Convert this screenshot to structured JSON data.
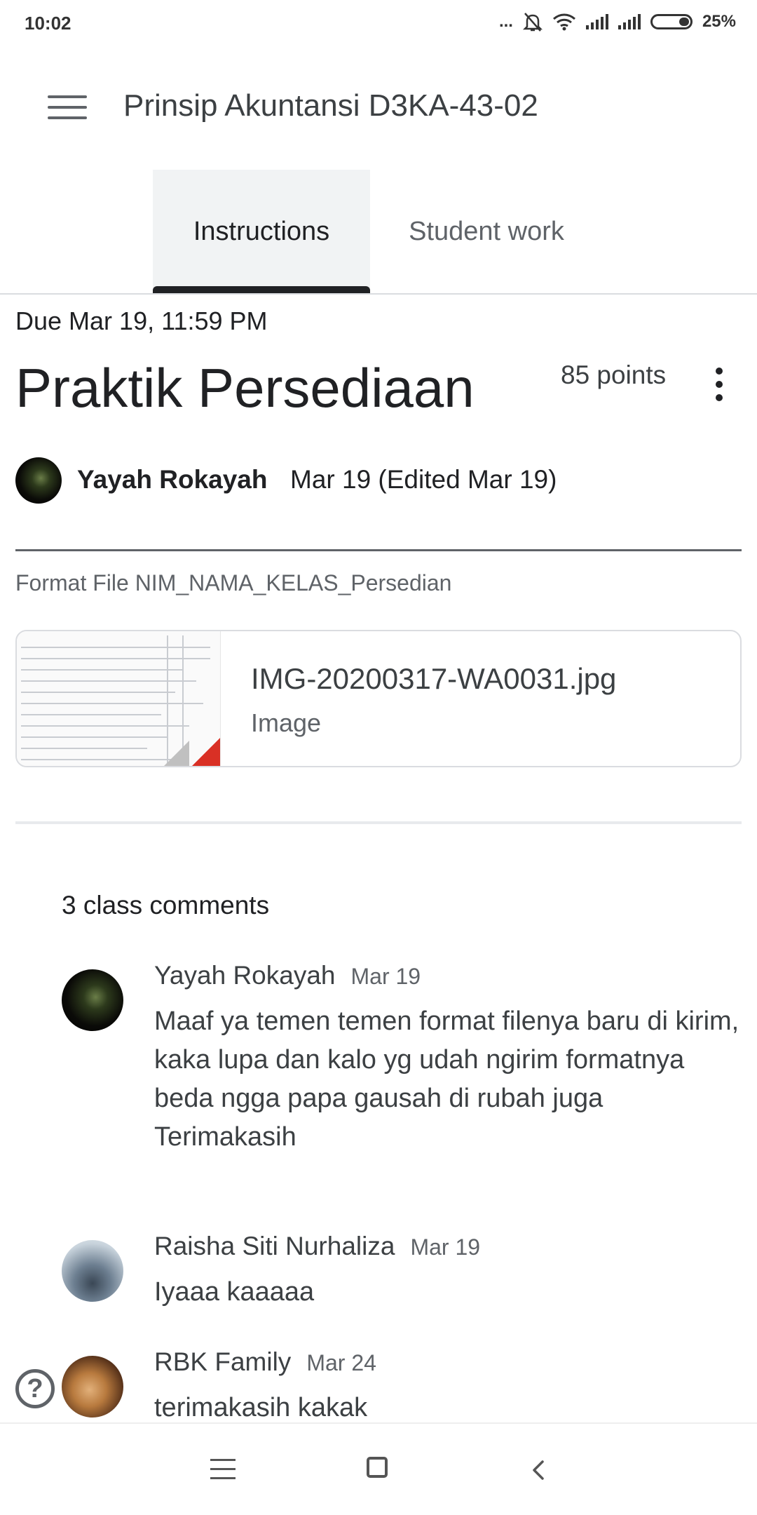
{
  "status_bar": {
    "time": "10:02",
    "dots": "...",
    "battery": "25%"
  },
  "app_bar": {
    "title": "Prinsip Akuntansi D3KA-43-02"
  },
  "tabs": [
    {
      "label": "Instructions",
      "active": true
    },
    {
      "label": "Student work",
      "active": false
    }
  ],
  "assignment": {
    "due": "Due Mar 19, 11:59 PM",
    "title": "Praktik Persediaan",
    "points": "85 points",
    "author": "Yayah Rokayah",
    "date": "Mar 19 (Edited Mar 19)",
    "description": "Format File NIM_NAMA_KELAS_Persedian",
    "attachment": {
      "name": "IMG-20200317-WA0031.jpg",
      "type": "Image"
    }
  },
  "comments": {
    "header": "3 class comments",
    "items": [
      {
        "author": "Yayah Rokayah",
        "date": "Mar 19",
        "text": "Maaf ya temen temen format filenya baru di kirim, kaka lupa dan kalo yg udah ngirim formatnya beda ngga papa gausah di rubah juga",
        "text2": "Terimakasih"
      },
      {
        "author": "Raisha Siti Nurhaliza",
        "date": "Mar 19",
        "text": "Iyaaa kaaaaa"
      },
      {
        "author": "RBK Family",
        "date": "Mar 24",
        "text": "terimakasih kakak"
      }
    ]
  },
  "icons": {
    "menu": "hamburger-menu-icon",
    "more": "more-vert-icon",
    "help": "help-icon",
    "help_glyph": "?",
    "nav_back_glyph": "‹"
  },
  "colors": {
    "text_primary": "#202124",
    "text_secondary": "#5f6368",
    "tab_active_bg": "#f1f3f4",
    "attachment_corner": "#d93025"
  }
}
